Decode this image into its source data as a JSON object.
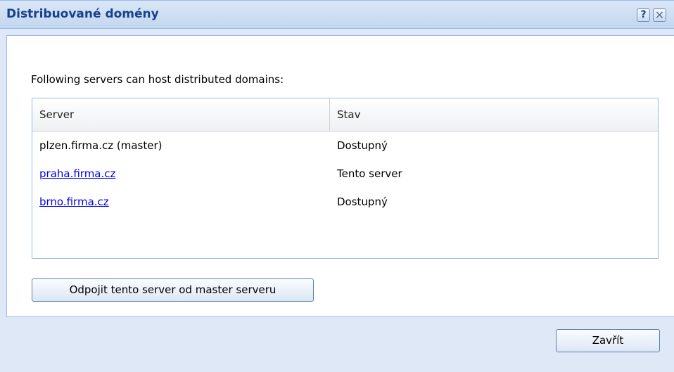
{
  "dialog": {
    "title": "Distribuované domény",
    "help_glyph": "?",
    "close_glyph": "✕"
  },
  "intro_text": "Following servers can host distributed domains:",
  "grid": {
    "columns": [
      "Server",
      "Stav"
    ],
    "rows": [
      {
        "server": "plzen.firma.cz  (master)",
        "status": "Dostupný",
        "link": false
      },
      {
        "server": "praha.firma.cz",
        "status": "Tento server",
        "link": true
      },
      {
        "server": "brno.firma.cz",
        "status": "Dostupný",
        "link": true
      }
    ]
  },
  "buttons": {
    "disconnect_label": "Odpojit tento server od master serveru",
    "close_label": "Zavřít"
  }
}
